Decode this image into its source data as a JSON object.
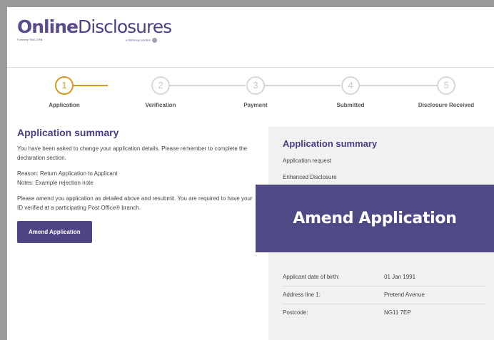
{
  "logo": {
    "part1": "Online",
    "part2": "Disclosures",
    "tagline_left": "Formerly TMG CRB",
    "tagline_right": "a GBGroup solution"
  },
  "steps": [
    {
      "number": "1",
      "label": "Application",
      "active": true
    },
    {
      "number": "2",
      "label": "Verification",
      "active": false
    },
    {
      "number": "3",
      "label": "Payment",
      "active": false
    },
    {
      "number": "4",
      "label": "Submitted",
      "active": false
    },
    {
      "number": "5",
      "label": "Disclosure Received",
      "active": false
    }
  ],
  "left": {
    "title": "Application summary",
    "intro": "You have been asked to change your application details. Please remember to complete the declaration section.",
    "reason": "Reason: Return Application to Applicant",
    "notes": "Notes: Example rejection note",
    "instructions": "Please amend you application as detailed above and resubmit. You are required to have your ID verified at a participating Post Office® branch.",
    "button": "Amend Application"
  },
  "panel": {
    "title": "Application summary",
    "request": "Application request",
    "disclosure": "Enhanced Disclosure",
    "rows": [
      {
        "k": "Applicant date of birth:",
        "v": "01 Jan 1991"
      },
      {
        "k": "Address line 1:",
        "v": "Pretend Avenue"
      },
      {
        "k": "Postcode:",
        "v": "NG11 7EP"
      }
    ]
  },
  "overlay": {
    "label": "Amend Application"
  },
  "colors": {
    "brand": "#4e4585",
    "step_active": "#d39a1e",
    "panel_bg": "#f1f1f1"
  }
}
